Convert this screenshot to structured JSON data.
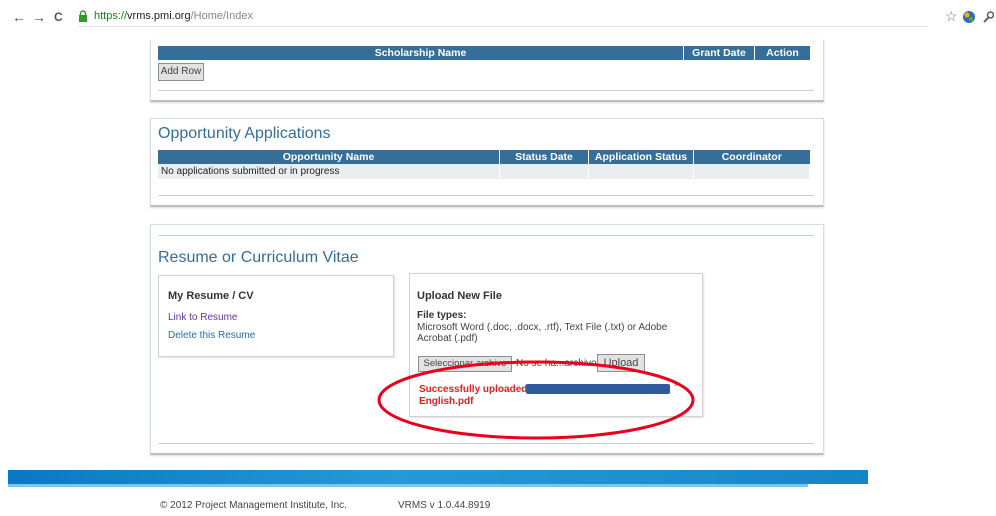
{
  "browser": {
    "url_scheme": "https://",
    "url_host": "vrms.pmi.org",
    "url_path": "/Home/Index",
    "back": "←",
    "forward": "→",
    "reload": "C",
    "star": "☆"
  },
  "scholarships": {
    "columns": [
      "Scholarship Name",
      "Grant Date",
      "Action"
    ],
    "add_row_label": "Add Row"
  },
  "opportunities": {
    "title": "Opportunity Applications",
    "columns": [
      "Opportunity Name",
      "Status Date",
      "Application Status",
      "Coordinator"
    ],
    "rows": [
      [
        "No applications submitted or in progress",
        "",
        "",
        ""
      ]
    ]
  },
  "resume": {
    "title": "Resume or Curriculum Vitae",
    "my_resume": {
      "heading": "My Resume / CV",
      "link_label": "Link to Resume",
      "delete_label": "Delete this Resume"
    },
    "upload": {
      "heading": "Upload New File",
      "file_types_label": "File types:",
      "file_types_text": "Microsoft Word (.doc, .docx, .rtf), Text File (.txt) or Adobe Acrobat (.pdf)",
      "choose_button": "Seleccionar archivo",
      "file_status": "No se ha...archivo",
      "upload_button": "Upload",
      "success_prefix": "Successfully uploaded",
      "success_suffix": "English.pdf"
    }
  },
  "footer": {
    "copyright": "© 2012 Project Management Institute, Inc.",
    "version": "VRMS v 1.0.44.8919"
  },
  "colors": {
    "header_blue": "#356e98",
    "success_red": "#e02020",
    "annotation_red": "#e8001c",
    "redaction_blue": "#2f5a9e"
  }
}
